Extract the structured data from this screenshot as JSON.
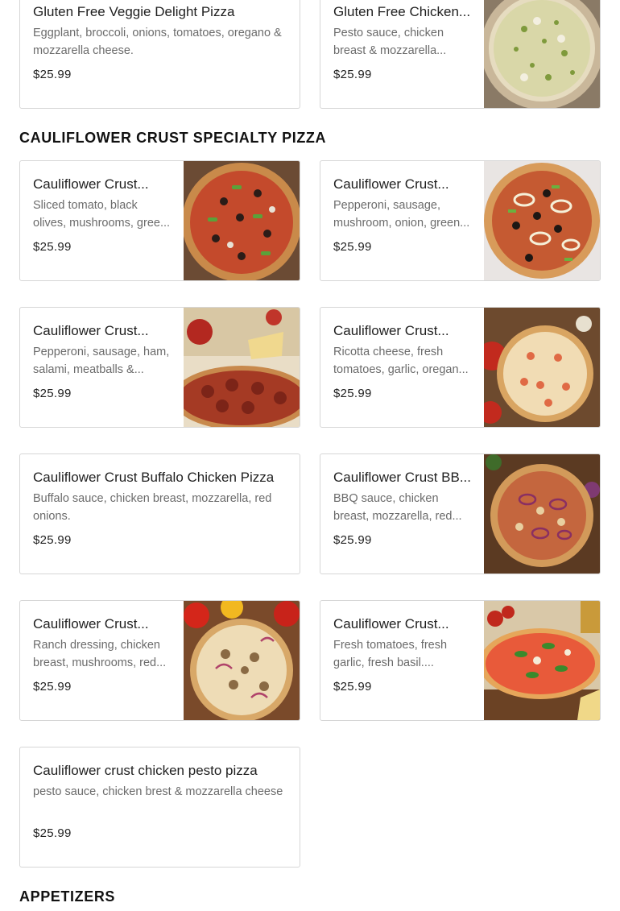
{
  "sections": {
    "cauliflower_title": "CAULIFLOWER CRUST SPECIALTY PIZZA",
    "appetizers_title": "APPETIZERS"
  },
  "gluten_free": [
    {
      "name": "Gluten Free Veggie Delight Pizza",
      "desc": "Eggplant, broccoli, onions, tomatoes, oregano & mozzarella cheese.",
      "price": "$25.99"
    },
    {
      "name": "Gluten Free Chicken...",
      "desc": "Pesto sauce, chicken breast & mozzarella...",
      "price": "$25.99",
      "image": "pesto-chicken-pizza-photo"
    }
  ],
  "cauliflower": [
    {
      "name": "Cauliflower Crust...",
      "desc": "Sliced tomato, black olives, mushrooms, gree...",
      "price": "$25.99",
      "image": "veggie-pizza-photo"
    },
    {
      "name": "Cauliflower Crust...",
      "desc": "Pepperoni, sausage, mushroom, onion, green...",
      "price": "$25.99",
      "image": "supreme-pizza-photo"
    },
    {
      "name": "Cauliflower Crust...",
      "desc": "Pepperoni, sausage, ham, salami, meatballs &...",
      "price": "$25.99",
      "image": "meat-lovers-pizza-photo"
    },
    {
      "name": "Cauliflower Crust...",
      "desc": "Ricotta cheese, fresh tomatoes, garlic, oregan...",
      "price": "$25.99",
      "image": "white-pizza-photo"
    },
    {
      "name": "Cauliflower Crust Buffalo Chicken Pizza",
      "desc": "Buffalo sauce, chicken breast, mozzarella, red onions.",
      "price": "$25.99"
    },
    {
      "name": "Cauliflower Crust BB...",
      "desc": "BBQ sauce, chicken breast, mozzarella, red...",
      "price": "$25.99",
      "image": "bbq-chicken-pizza-photo"
    },
    {
      "name": "Cauliflower Crust...",
      "desc": "Ranch dressing, chicken breast, mushrooms, red...",
      "price": "$25.99",
      "image": "ranch-chicken-pizza-photo"
    },
    {
      "name": "Cauliflower Crust...",
      "desc": "Fresh tomatoes, fresh garlic, fresh basil....",
      "price": "$25.99",
      "image": "margherita-pizza-photo"
    },
    {
      "name": "Cauliflower crust chicken pesto pizza",
      "desc": "pesto sauce, chicken brest & mozzarella cheese",
      "price": "$25.99"
    }
  ]
}
